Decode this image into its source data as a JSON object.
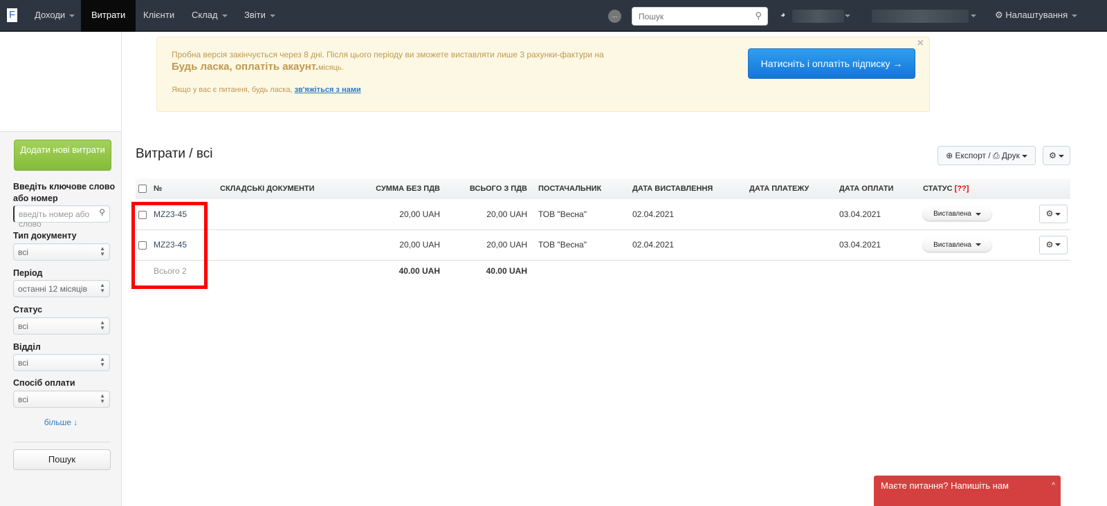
{
  "nav": {
    "logo": "F",
    "items": [
      {
        "label": "Доходи",
        "caret": true
      },
      {
        "label": "Витрати",
        "active": true
      },
      {
        "label": "Клієнти"
      },
      {
        "label": "Склад",
        "caret": true
      },
      {
        "label": "Звіти",
        "caret": true
      }
    ],
    "notif": "...",
    "search_placeholder": "Пошук",
    "settings": "Налаштування"
  },
  "alert": {
    "line1": "Пробна версія закінчується через 8 дні. Після цього періоду ви зможете виставляти лише 3 рахунки-фактури на",
    "line2": "Будь ласка, оплатіть акаунт.",
    "line2_suffix": "місяць.",
    "line3": "Якщо у вас є питання, будь ласка,",
    "link": "зв'яжіться з нами",
    "pay_button": "Натисніть і оплатіть підписку →",
    "close": "×"
  },
  "sidebar": {
    "add_button": "Додати нові витрати",
    "keyword_label": "Введіть ключове слово або номер",
    "keyword_placeholder": "введіть номер або слово",
    "filters": [
      {
        "label": "Тип документу",
        "value": "всі"
      },
      {
        "label": "Період",
        "value": "останні 12 місяців"
      },
      {
        "label": "Статус",
        "value": "всі"
      },
      {
        "label": "Відділ",
        "value": "всі"
      },
      {
        "label": "Спосіб оплати",
        "value": "всі"
      }
    ],
    "more": "більше ↓",
    "search_button": "Пошук"
  },
  "main": {
    "title": "Витрати / всі",
    "export": "Експорт / ⎙ Друк",
    "columns": [
      "№",
      "СКЛАДСЬКІ ДОКУМЕНТИ",
      "СУММА БЕЗ ПДВ",
      "ВСЬОГО З ПДВ",
      "ПОСТАЧАЛЬНИК",
      "ДАТА ВИСТАВЛЕННЯ",
      "ДАТА ПЛАТЕЖУ",
      "ДАТА ОПЛАТИ",
      "СТАТУС"
    ],
    "status_help": "[??]",
    "rows": [
      {
        "number": "MZ23-45",
        "docs": "",
        "net": "20,00 UAH",
        "gross": "20,00 UAH",
        "supplier": "ТОВ \"Весна\"",
        "issued": "02.04.2021",
        "due": "",
        "paid": "03.04.2021",
        "status": "Виставлена"
      },
      {
        "number": "MZ23-45",
        "docs": "",
        "net": "20,00 UAH",
        "gross": "20,00 UAH",
        "supplier": "ТОВ \"Весна\"",
        "issued": "02.04.2021",
        "due": "",
        "paid": "03.04.2021",
        "status": "Виставлена"
      }
    ],
    "total": {
      "label": "Всього 2",
      "net": "40.00 UAH",
      "gross": "40.00 UAH"
    }
  },
  "chat": {
    "label": "Маєте питання? Напишіть нам",
    "toggle": "^"
  }
}
